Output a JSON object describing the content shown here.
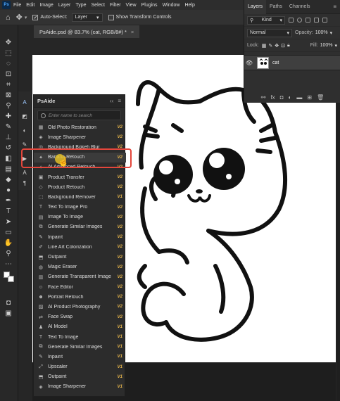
{
  "menubar": {
    "logo": "Ps",
    "items": [
      "File",
      "Edit",
      "Image",
      "Layer",
      "Type",
      "Select",
      "Filter",
      "View",
      "Plugins",
      "Window",
      "Help"
    ]
  },
  "options": {
    "auto_select_label": "Auto-Select:",
    "auto_select_value": "Layer",
    "show_transform_label": "Show Transform Controls"
  },
  "document": {
    "tab_title": "PsAide.psd @ 83.7% (cat, RGB/8#) *",
    "close": "×"
  },
  "layers": {
    "tabs": [
      "Layers",
      "Paths",
      "Channels"
    ],
    "kind_label": "Kind",
    "blend_mode": "Normal",
    "opacity_label": "Opacity:",
    "opacity_value": "100%",
    "lock_label": "Lock:",
    "fill_label": "Fill:",
    "fill_value": "100%",
    "layer_name": "cat",
    "footer_icons": [
      "link-icon",
      "fx-icon",
      "mask-icon",
      "adjustment-icon",
      "folder-icon",
      "new-layer-icon",
      "trash-icon"
    ]
  },
  "psaide": {
    "title": "PsAide",
    "search_placeholder": "Enter name to search",
    "items": [
      {
        "label": "Old Photo Restoration",
        "badge": "V2"
      },
      {
        "label": "Image Sharpener",
        "badge": "V2"
      },
      {
        "label": "Background Bokeh Blur",
        "badge": "V2"
      },
      {
        "label": "Banana Retouch",
        "badge": "V2"
      },
      {
        "label": "AI Advanced Retouch",
        "badge": "V2"
      },
      {
        "label": "Product Transfer",
        "badge": "V2"
      },
      {
        "label": "Product Retouch",
        "badge": "V2"
      },
      {
        "label": "Background Remover",
        "badge": "V1"
      },
      {
        "label": "Text To Image Pro",
        "badge": "V2"
      },
      {
        "label": "Image To Image",
        "badge": "V2"
      },
      {
        "label": "Generate Similar Images",
        "badge": "V2"
      },
      {
        "label": "Inpaint",
        "badge": "V2"
      },
      {
        "label": "Line Art Colorization",
        "badge": "V2"
      },
      {
        "label": "Outpaint",
        "badge": "V2"
      },
      {
        "label": "Magic Eraser",
        "badge": "V2"
      },
      {
        "label": "Generate Transparent Image",
        "badge": "V2"
      },
      {
        "label": "Face Editor",
        "badge": "V2"
      },
      {
        "label": "Portrait Retouch",
        "badge": "V2"
      },
      {
        "label": "AI Product Photography",
        "badge": "V2"
      },
      {
        "label": "Face Swap",
        "badge": "V2"
      },
      {
        "label": "AI Model",
        "badge": "V1"
      },
      {
        "label": "Text To Image",
        "badge": "V1"
      },
      {
        "label": "Generate Similar Images",
        "badge": "V1"
      },
      {
        "label": "Inpaint",
        "badge": "V1"
      },
      {
        "label": "Upscaler",
        "badge": "V1"
      },
      {
        "label": "Outpaint",
        "badge": "V1"
      },
      {
        "label": "Image Sharpener",
        "badge": "V1"
      }
    ]
  }
}
